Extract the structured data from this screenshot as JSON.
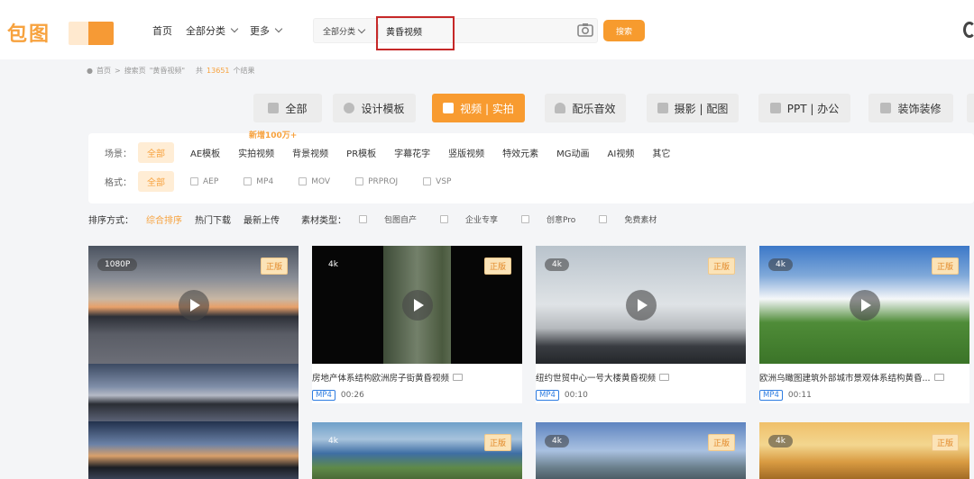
{
  "header": {
    "logo_text": "包图",
    "nav": [
      {
        "label": "首页",
        "has_dropdown": false
      },
      {
        "label": "全部分类",
        "has_dropdown": true
      },
      {
        "label": "更多",
        "has_dropdown": true
      }
    ],
    "search": {
      "scope": "全部分类",
      "query": "黄昏视频",
      "button": "搜索"
    },
    "colors": {
      "accent": "#f79b2e",
      "highlight_box": "#c62828"
    }
  },
  "breadcrumb": {
    "home": "首页",
    "sep": ">",
    "search_page": "搜索页",
    "keyword": "\"黄昏视频\"",
    "total_prefix": "共",
    "count": "13651",
    "total_suffix": "个结果"
  },
  "categories": [
    {
      "label": "全部",
      "icon": "grid-icon",
      "active": false
    },
    {
      "label": "设计模板",
      "icon": "palette-icon",
      "active": false
    },
    {
      "label": "视频 | 实拍",
      "icon": "video-icon",
      "active": true
    },
    {
      "label": "配乐音效",
      "icon": "headphones-icon",
      "active": false
    },
    {
      "label": "摄影 | 配图",
      "icon": "camera-icon",
      "active": false
    },
    {
      "label": "PPT | 办公",
      "icon": "folder-icon",
      "active": false
    },
    {
      "label": "装饰装修",
      "icon": "paint-roller-icon",
      "active": false
    },
    {
      "label": "",
      "icon": "more-icon",
      "active": false
    }
  ],
  "promo": "新增100万+",
  "filters": {
    "scene_label": "场景：",
    "scene_all": "全部",
    "scene_items": [
      "AE模板",
      "实拍视频",
      "背景视频",
      "PR模板",
      "字幕花字",
      "竖版视频",
      "特效元素",
      "MG动画",
      "AI视频",
      "其它"
    ],
    "format_label": "格式：",
    "format_all": "全部",
    "format_items": [
      "AEP",
      "MP4",
      "MOV",
      "PRPROJ",
      "VSP"
    ]
  },
  "sort": {
    "label": "排序方式：",
    "options": [
      "综合排序",
      "热门下载",
      "最新上传"
    ],
    "active": "综合排序",
    "type_label": "素材类型：",
    "types": [
      "包图自产",
      "企业专享",
      "创意Pro",
      "免费素材"
    ]
  },
  "cards": [
    {
      "resolution": "1080P",
      "badge": "正版",
      "title": "",
      "format": "",
      "duration": ""
    },
    {
      "resolution": "4k",
      "badge": "正版",
      "title": "房地产体系结构欧洲房子街黄昏视频",
      "format": "MP4",
      "duration": "00:26"
    },
    {
      "resolution": "4k",
      "badge": "正版",
      "title": "纽约世贸中心一号大楼黄昏视频",
      "format": "MP4",
      "duration": "00:10"
    },
    {
      "resolution": "4k",
      "badge": "正版",
      "title": "欧洲乌瞰图建筑外部城市景观体系结构黄昏...",
      "format": "MP4",
      "duration": "00:11"
    }
  ],
  "cards_row2": [
    {
      "resolution": "4k",
      "badge": "正版"
    },
    {
      "resolution": "4k",
      "badge": "正版"
    },
    {
      "resolution": "4k",
      "badge": "正版"
    }
  ]
}
